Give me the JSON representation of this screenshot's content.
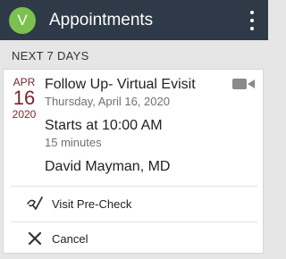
{
  "colors": {
    "appbar_bg": "#2e3a48",
    "avatar_bg": "#7cc04f",
    "date_accent": "#7a2630",
    "background": "#e6e6e6"
  },
  "appbar": {
    "avatar_initial": "V",
    "title": "Appointments",
    "menu_icon": "more-vert-icon"
  },
  "section": {
    "header": "NEXT 7 DAYS"
  },
  "appointment": {
    "month": "APR",
    "day": "16",
    "year": "2020",
    "title": "Follow Up- Virtual Evisit",
    "date_full": "Thursday, April 16, 2020",
    "starts": "Starts at 10:00 AM",
    "duration": "15 minutes",
    "provider": "David Mayman, MD",
    "type_icon": "video-camera-icon"
  },
  "actions": [
    {
      "label": "Visit Pre-Check",
      "icon": "pre-check-icon"
    },
    {
      "label": "Cancel",
      "icon": "close-icon"
    }
  ]
}
